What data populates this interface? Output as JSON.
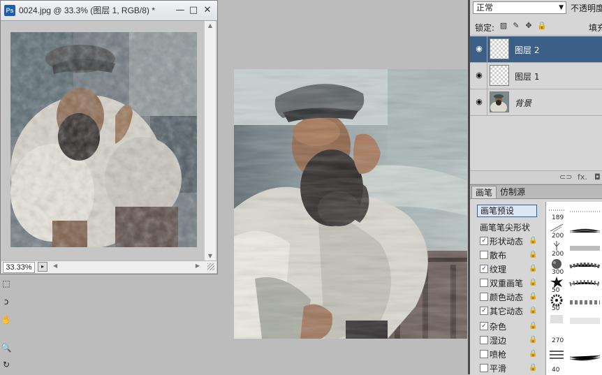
{
  "document_window": {
    "title": "0024.jpg @ 33.3% (图层 1, RGB/8) *",
    "app_icon": "Ps",
    "zoom": "33.33%",
    "minimize": "—",
    "maximize": "□",
    "close": "✕"
  },
  "tools": [
    {
      "icon": "marquee-icon",
      "glyph": "⬚"
    },
    {
      "icon": "lasso-icon",
      "glyph": "ↄ"
    },
    {
      "icon": "hand-icon",
      "glyph": "✋"
    },
    {
      "icon": "zoom-icon",
      "glyph": "🔍"
    },
    {
      "icon": "rotate-icon",
      "glyph": "↻"
    }
  ],
  "layers_panel": {
    "blend_mode": "正常",
    "opacity_label": "不透明度",
    "lock_label": "锁定:",
    "fill_label": "填充",
    "layers": [
      {
        "name": "图层 2",
        "selected": true,
        "visible": true,
        "kind": "transparent"
      },
      {
        "name": "图层 1",
        "selected": false,
        "visible": true,
        "kind": "transparent"
      },
      {
        "name": "背景",
        "selected": false,
        "visible": true,
        "kind": "background"
      }
    ],
    "footer_icons": [
      "link-icon",
      "fx-icon",
      "mask-icon"
    ],
    "footer_glyphs": [
      "⊂⊃",
      "fx.",
      "◘"
    ]
  },
  "brush_panel": {
    "tabs": [
      "画笔",
      "仿制源"
    ],
    "active_tab": "画笔",
    "preset_button": "画笔预设",
    "tip_shape": "画笔笔尖形状",
    "options": [
      {
        "label": "形状动态",
        "checked": true
      },
      {
        "label": "散布",
        "checked": false
      },
      {
        "label": "纹理",
        "checked": true
      },
      {
        "label": "双重画笔",
        "checked": false
      },
      {
        "label": "颜色动态",
        "checked": false
      },
      {
        "label": "其它动态",
        "checked": true
      },
      {
        "label": "杂色",
        "checked": true
      },
      {
        "label": "湿边",
        "checked": false
      },
      {
        "label": "喷枪",
        "checked": false
      },
      {
        "label": "平滑",
        "checked": false
      }
    ],
    "preset_sizes": [
      "189",
      "200",
      "200",
      "300",
      "50",
      "50",
      "270",
      "40"
    ]
  }
}
